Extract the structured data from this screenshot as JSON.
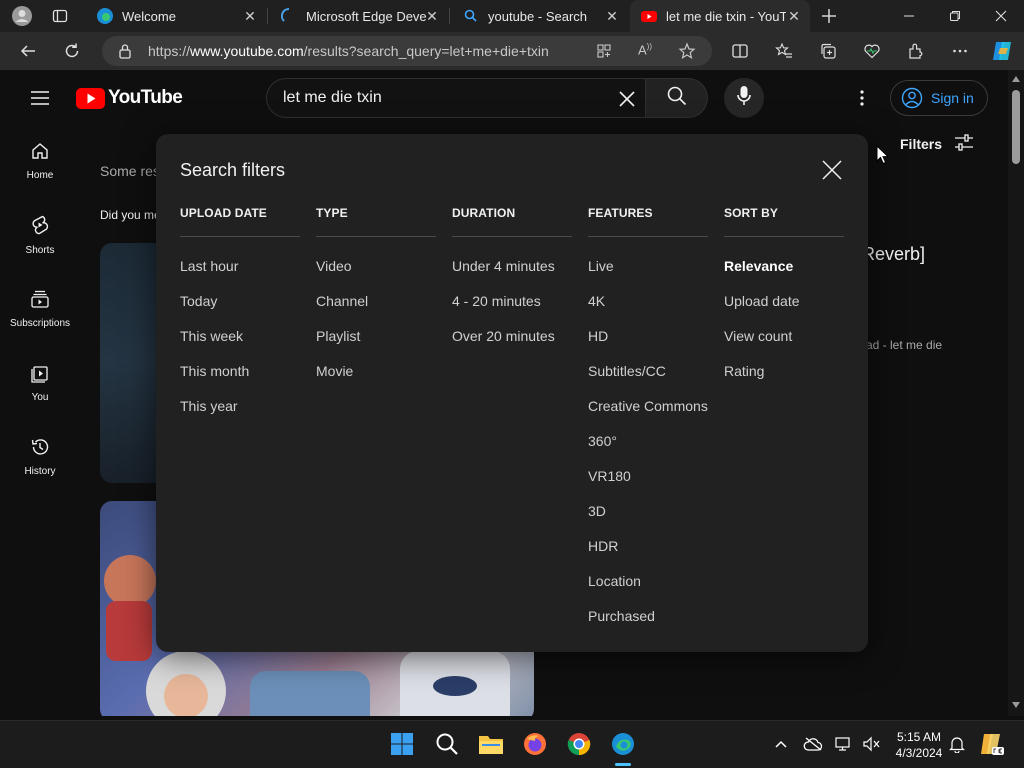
{
  "browser": {
    "tabs": [
      {
        "title": "Welcome"
      },
      {
        "title": "Microsoft Edge Devel"
      },
      {
        "title": "youtube - Search"
      },
      {
        "title": "let me die txin - YouT"
      }
    ],
    "address": {
      "prefix": "https://",
      "host": "www.youtube.com",
      "path": "/results?search_query=let+me+die+txin"
    }
  },
  "youtube": {
    "logo_text": "YouTube",
    "search_value": "let me die txin",
    "sign_in_label": "Sign in",
    "filters_label": "Filters",
    "guide": [
      {
        "label": "Home",
        "icon": "home-icon"
      },
      {
        "label": "Shorts",
        "icon": "shorts-icon"
      },
      {
        "label": "Subscriptions",
        "icon": "subscriptions-icon"
      },
      {
        "label": "You",
        "icon": "you-icon"
      },
      {
        "label": "History",
        "icon": "history-icon"
      }
    ],
    "background_fragments": {
      "some_results": "Some res",
      "did_you_mean": "Did you me",
      "video_title_fragment": "Reverb]",
      "video_desc_fragment": "ad - let me die"
    }
  },
  "dialog": {
    "title": "Search filters",
    "columns": [
      {
        "heading": "UPLOAD DATE",
        "options": [
          "Last hour",
          "Today",
          "This week",
          "This month",
          "This year"
        ]
      },
      {
        "heading": "TYPE",
        "options": [
          "Video",
          "Channel",
          "Playlist",
          "Movie"
        ]
      },
      {
        "heading": "DURATION",
        "options": [
          "Under 4 minutes",
          "4 - 20 minutes",
          "Over 20 minutes"
        ]
      },
      {
        "heading": "FEATURES",
        "options": [
          "Live",
          "4K",
          "HD",
          "Subtitles/CC",
          "Creative Commons",
          "360°",
          "VR180",
          "3D",
          "HDR",
          "Location",
          "Purchased"
        ]
      },
      {
        "heading": "SORT BY",
        "options": [
          "Relevance",
          "Upload date",
          "View count",
          "Rating"
        ],
        "selected": "Relevance"
      }
    ]
  },
  "taskbar": {
    "time": "5:15 AM",
    "date": "4/3/2024"
  },
  "colors": {
    "yt_red": "#ff0000",
    "link_blue": "#3ea6ff",
    "dialog_bg": "#212121"
  }
}
